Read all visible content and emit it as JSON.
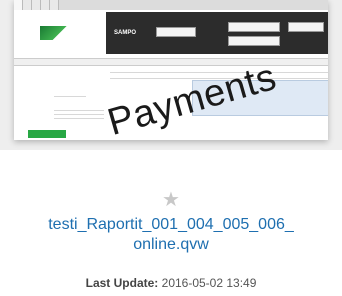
{
  "thumbnail": {
    "tabs": [
      "",
      "",
      "",
      "",
      ""
    ],
    "dark_bar_label": "SAMPO",
    "badge_text": "Payments",
    "star_icon": "star-icon"
  },
  "document": {
    "title_line1": "testi_Raportit_001_004_005_006_",
    "title_line2": "online.qvw",
    "last_update_label": "Last Update:",
    "last_update_value": "2016-05-02 13:49"
  },
  "colors": {
    "title": "#1e6fb0",
    "brand_green": "#27a744",
    "dark_bar": "#2c2c2c"
  }
}
